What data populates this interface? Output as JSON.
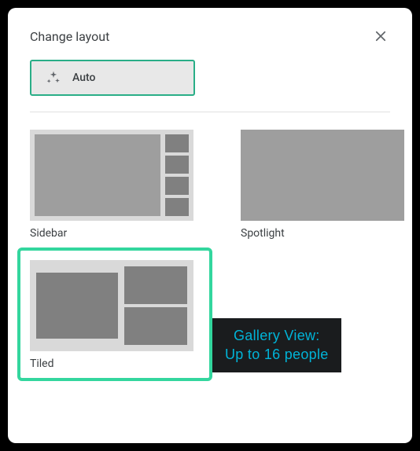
{
  "header": {
    "title": "Change layout"
  },
  "auto": {
    "label": "Auto"
  },
  "options": {
    "sidebar": {
      "label": "Sidebar"
    },
    "spotlight": {
      "label": "Spotlight"
    },
    "tiled": {
      "label": "Tiled",
      "selected": true
    }
  },
  "tooltip": {
    "line1": "Gallery View:",
    "line2": "Up to 16 people"
  }
}
